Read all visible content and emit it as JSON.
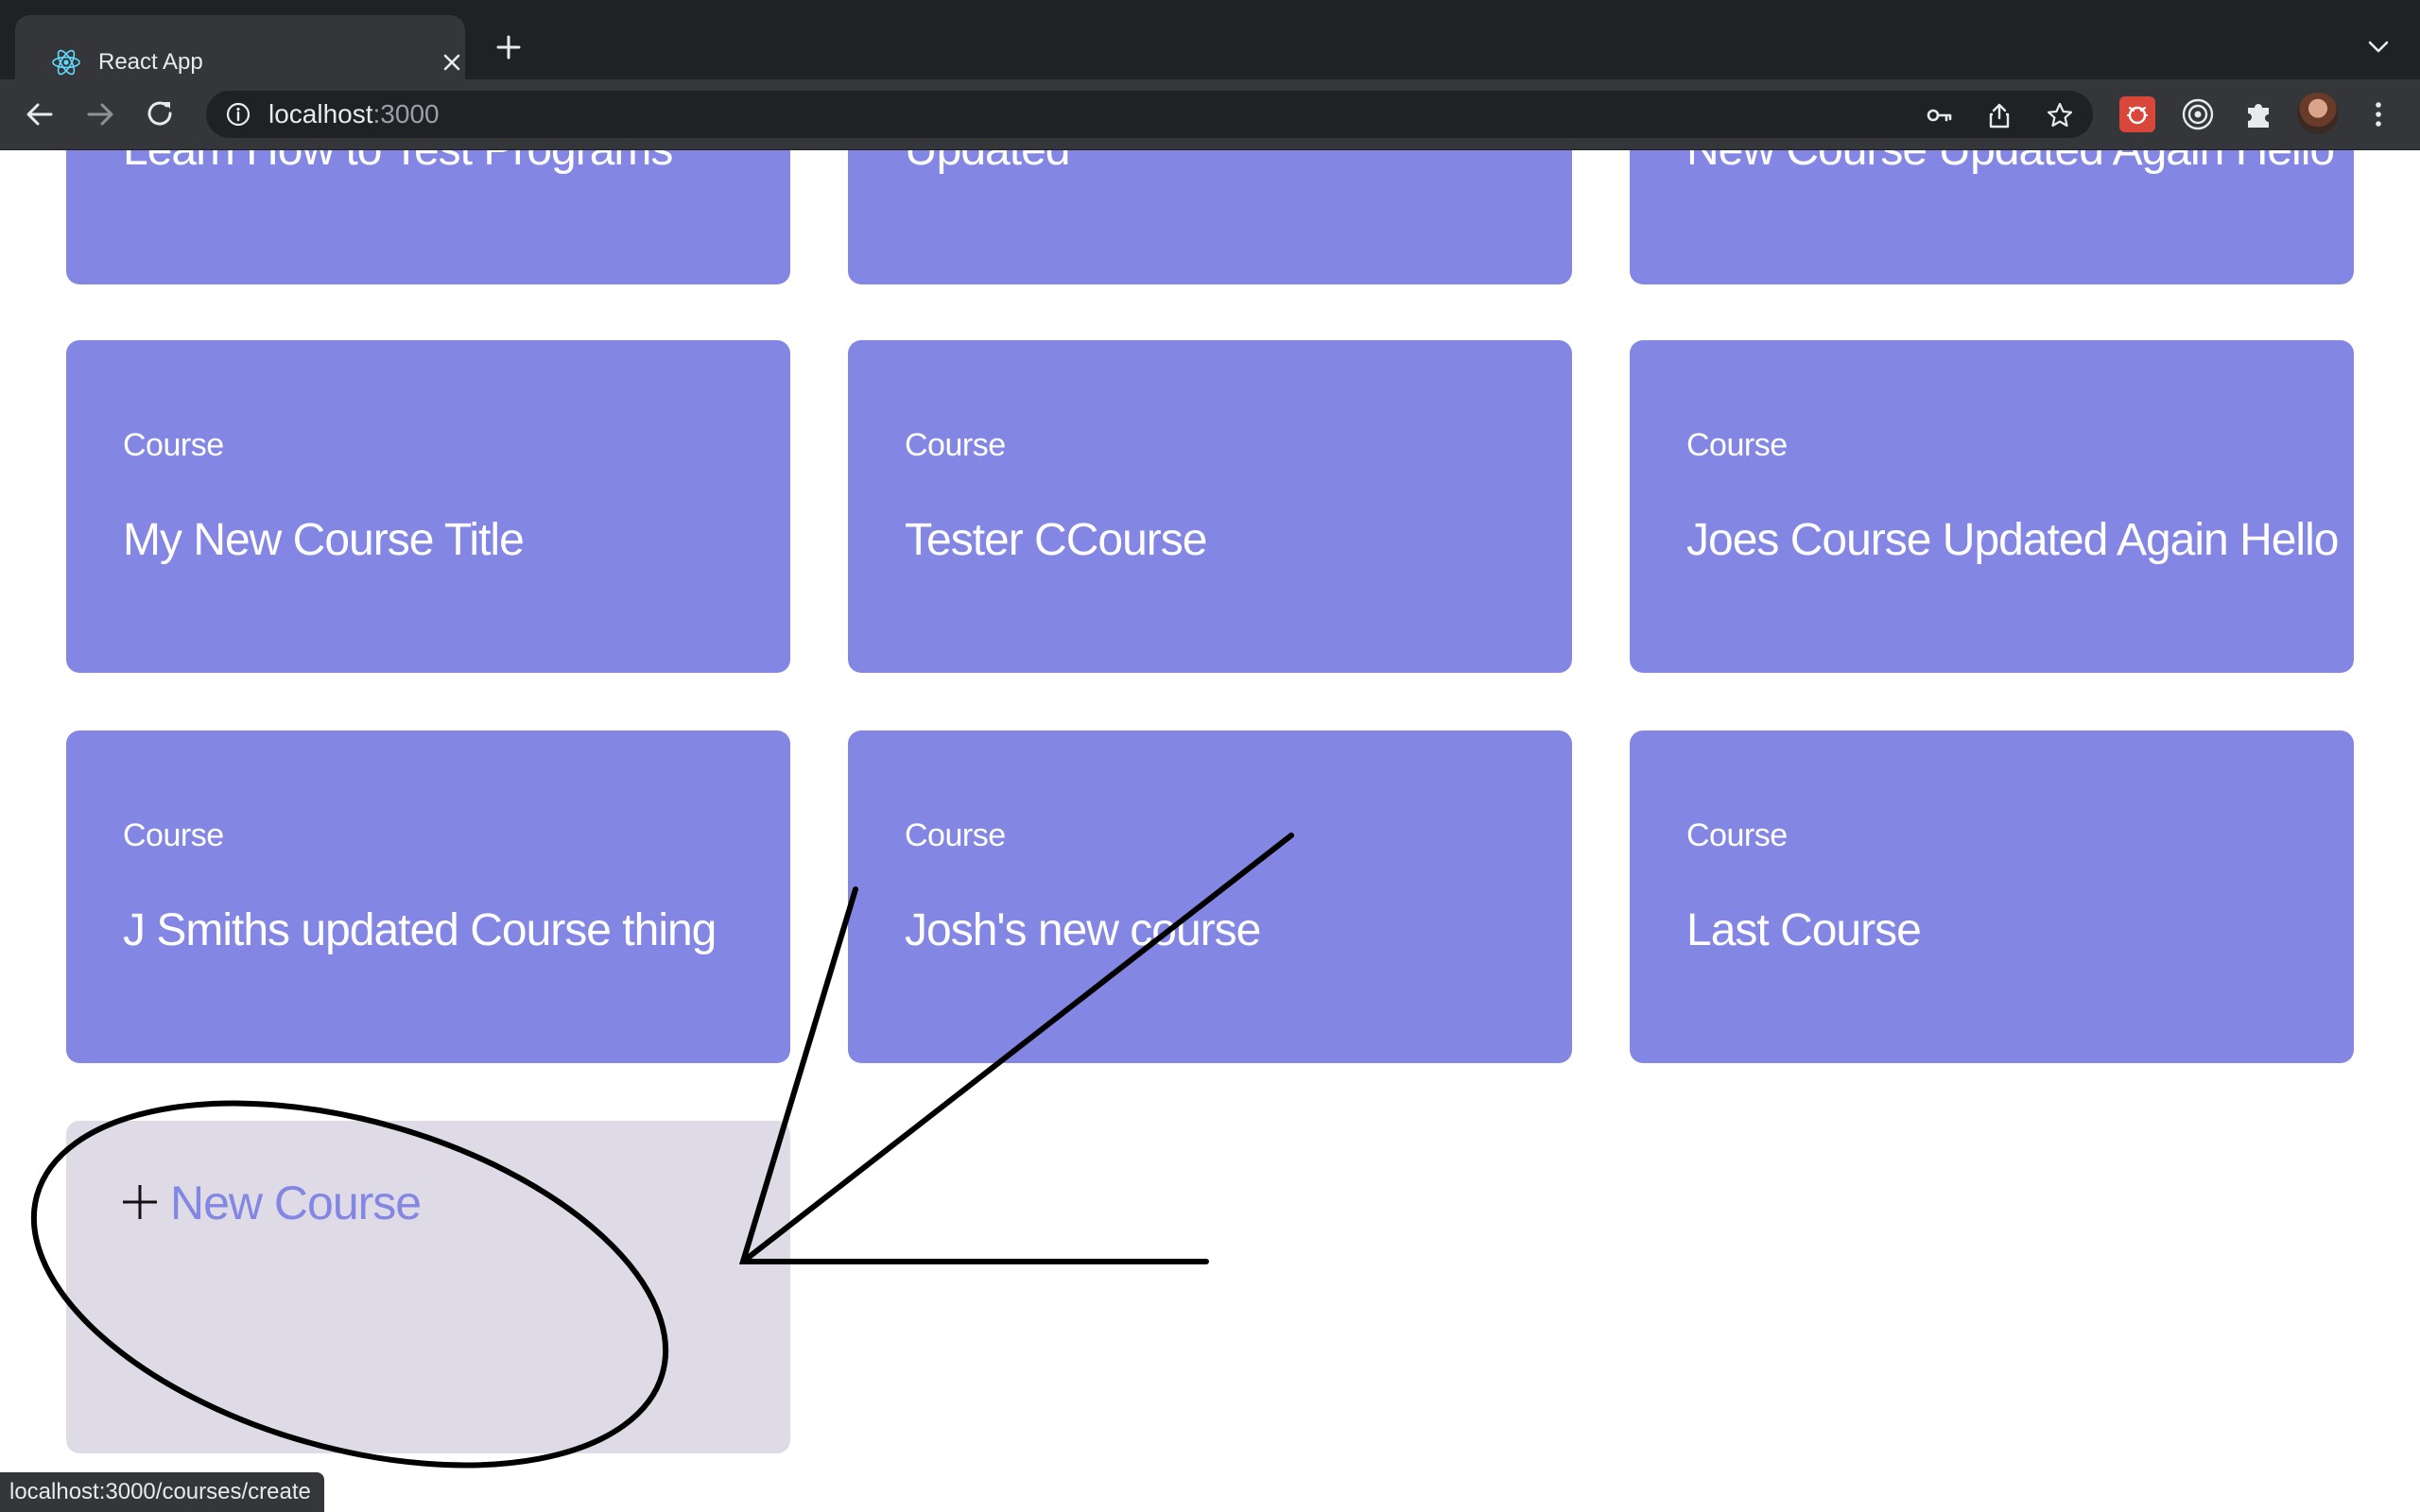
{
  "browser": {
    "tab_title": "React App",
    "url_host": "localhost",
    "url_port": ":3000",
    "status_url": "localhost:3000/courses/create"
  },
  "courses": {
    "top_row_titles": [
      "Learn How to Test Programs",
      "Updated",
      "New Course Updated Again Hello"
    ],
    "cards": [
      {
        "type": "Course",
        "title": "My New Course Title"
      },
      {
        "type": "Course",
        "title": "Tester CCourse"
      },
      {
        "type": "Course",
        "title": "Joes Course Updated Again Hello"
      },
      {
        "type": "Course",
        "title": "J Smiths updated Course thing"
      },
      {
        "type": "Course",
        "title": "Josh's new course"
      },
      {
        "type": "Course",
        "title": "Last Course"
      }
    ],
    "new_course_label": "New Course"
  },
  "colors": {
    "card_bg": "#8387e3",
    "new_card_bg": "#dedae6",
    "accent_text": "#8387e3",
    "chrome_dark": "#202124",
    "chrome_toolbar": "#35363a"
  },
  "icons": {
    "favicon": "react-logo-icon",
    "new_course": "plus-icon"
  }
}
